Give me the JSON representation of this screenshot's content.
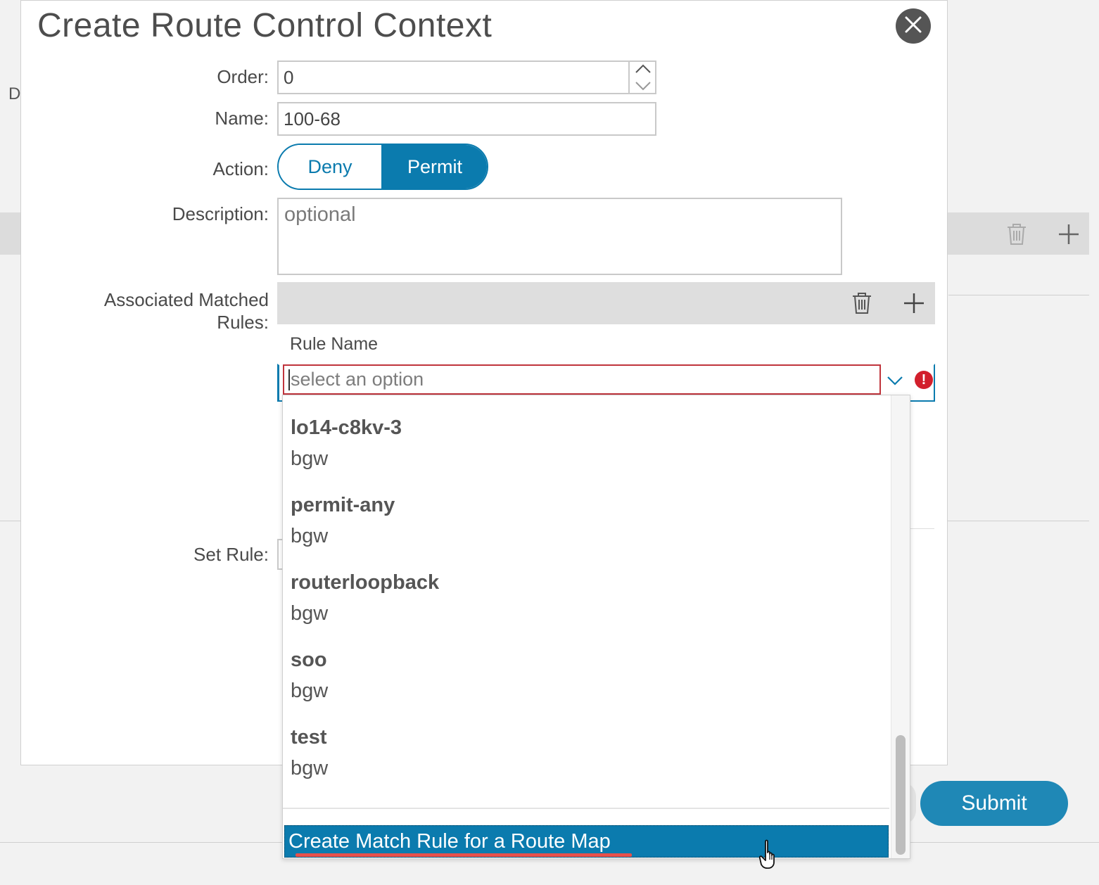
{
  "background": {
    "partial_letter": "D",
    "submit_label": "Submit"
  },
  "dialog": {
    "title": "Create Route Control Context",
    "close_icon": "close-icon",
    "order": {
      "label": "Order:",
      "value": "0"
    },
    "name": {
      "label": "Name:",
      "value": "100-68"
    },
    "action": {
      "label": "Action:",
      "options": [
        "Deny",
        "Permit"
      ],
      "selected": "Permit"
    },
    "description": {
      "label": "Description:",
      "placeholder": "optional"
    },
    "associated_matched_rules": {
      "label_line1": "Associated Matched",
      "label_line2": "Rules:",
      "toolbar_icons": [
        "trash-icon",
        "plus-icon"
      ],
      "column_header": "Rule Name",
      "select_placeholder": "select an option",
      "dropdown_options": [
        {
          "name": "lo14-c8kv-3",
          "tenant": "bgw"
        },
        {
          "name": "permit-any",
          "tenant": "bgw"
        },
        {
          "name": "routerloopback",
          "tenant": "bgw"
        },
        {
          "name": "soo",
          "tenant": "bgw"
        },
        {
          "name": "test",
          "tenant": "bgw"
        }
      ],
      "create_option": "Create Match Rule for a Route Map"
    },
    "set_rule": {
      "label": "Set Rule:"
    }
  },
  "colors": {
    "accent": "#0b7bae",
    "error": "#d21f2c",
    "highlight_underline": "#e8504a"
  }
}
